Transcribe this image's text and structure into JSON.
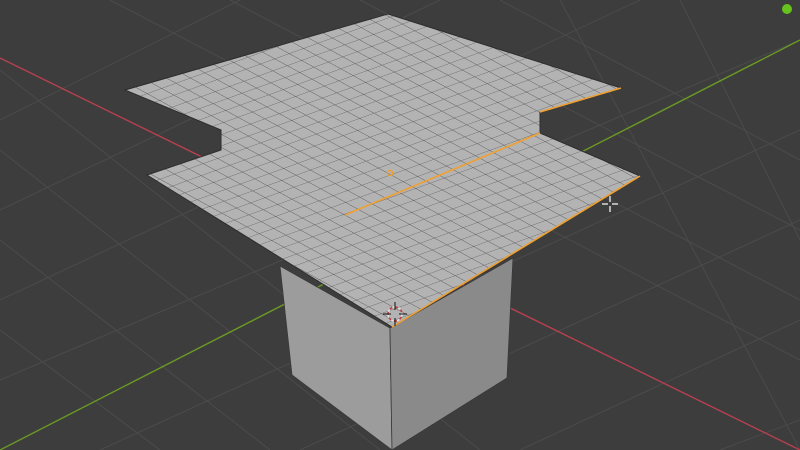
{
  "viewport": {
    "label": "3D Viewport",
    "colors": {
      "background": "#3d3d3d",
      "grid_line": "#505050",
      "x_axis": "#b8404f",
      "y_axis": "#6a9a23",
      "mesh_face": "#b3b3b3",
      "mesh_side_light": "#a3a3a3",
      "mesh_side_dark": "#7a7a7a",
      "wire": "#3a3a3a",
      "selection": "#f0a030",
      "origin_dot": "#f0a030",
      "status_dot": "#66c21d"
    },
    "icons": {
      "status": "status-dot-icon",
      "cursor": "move-cursor-icon",
      "origin": "origin-point-icon",
      "cursor3d": "3d-cursor-icon"
    }
  }
}
